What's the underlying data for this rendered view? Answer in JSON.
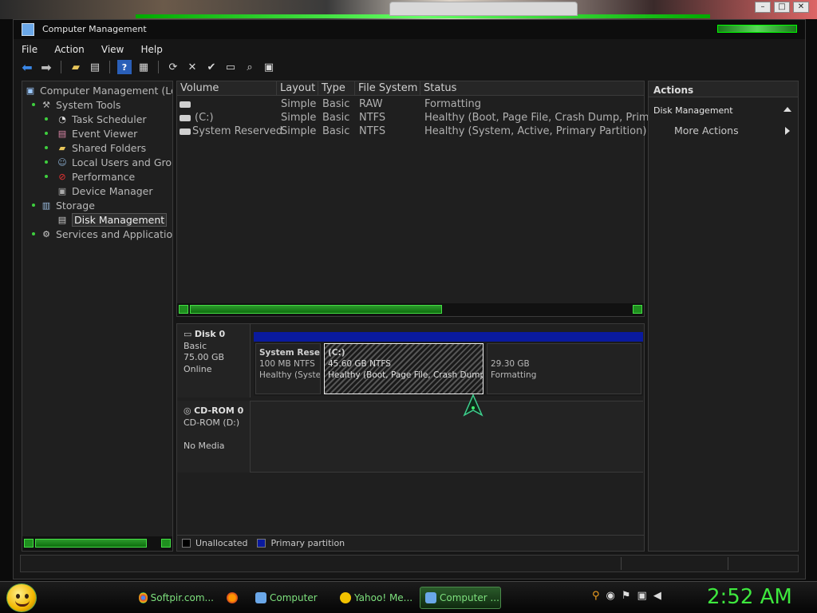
{
  "window": {
    "title": "Computer Management"
  },
  "menu": [
    "File",
    "Action",
    "View",
    "Help"
  ],
  "tree": {
    "root": "Computer Management (Loc",
    "items": [
      {
        "label": "System Tools",
        "level": 1
      },
      {
        "label": "Task Scheduler",
        "level": 2
      },
      {
        "label": "Event Viewer",
        "level": 2
      },
      {
        "label": "Shared Folders",
        "level": 2
      },
      {
        "label": "Local Users and Grou",
        "level": 2
      },
      {
        "label": "Performance",
        "level": 2
      },
      {
        "label": "Device Manager",
        "level": 2
      },
      {
        "label": "Storage",
        "level": 1
      },
      {
        "label": "Disk Management",
        "level": 2,
        "selected": true
      },
      {
        "label": "Services and Applications",
        "level": 1
      }
    ]
  },
  "volumes": {
    "columns": [
      "Volume",
      "Layout",
      "Type",
      "File System",
      "Status"
    ],
    "rows": [
      {
        "volume": "",
        "layout": "Simple",
        "type": "Basic",
        "fs": "RAW",
        "status": "Formatting"
      },
      {
        "volume": "(C:)",
        "layout": "Simple",
        "type": "Basic",
        "fs": "NTFS",
        "status": "Healthy (Boot, Page File, Crash Dump, Primary"
      },
      {
        "volume": "System Reserved",
        "layout": "Simple",
        "type": "Basic",
        "fs": "NTFS",
        "status": "Healthy (System, Active, Primary Partition)"
      }
    ]
  },
  "disks": {
    "disk0": {
      "name": "Disk 0",
      "kind": "Basic",
      "size": "75.00 GB",
      "state": "Online"
    },
    "partitions": [
      {
        "name": "System Rese",
        "size": "100 MB NTFS",
        "status": "Healthy (Syste"
      },
      {
        "name": "(C:)",
        "size": "45.60 GB NTFS",
        "status": "Healthy (Boot, Page File, Crash Dump, P"
      },
      {
        "name": "",
        "size": "29.30 GB",
        "status": "Formatting"
      }
    ],
    "cdrom": {
      "name": "CD-ROM 0",
      "drive": "CD-ROM (D:)",
      "state": "No Media"
    }
  },
  "legend": {
    "unallocated": "Unallocated",
    "primary": "Primary partition",
    "unallocated_color": "#000000",
    "primary_color": "#0a1a9e"
  },
  "actions": {
    "header": "Actions",
    "section": "Disk Management",
    "more": "More Actions"
  },
  "taskbar": {
    "tasks": [
      "Softpir.com...",
      "",
      "Computer",
      "Yahoo! Me...",
      "Computer ..."
    ],
    "clock": "2:52 AM"
  }
}
